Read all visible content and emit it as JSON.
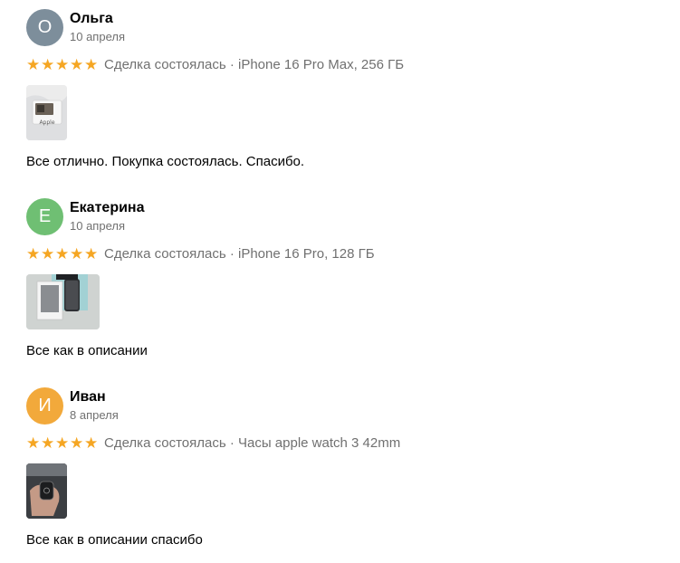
{
  "colors": {
    "star": "#f5a623",
    "secondary_text": "#707070",
    "primary_text": "#000000"
  },
  "reviews": [
    {
      "avatar_letter": "О",
      "avatar_color": "#7d8e9b",
      "name": "Ольга",
      "date": "10 апреля",
      "stars": 5,
      "deal": "Сделка состоялась · iPhone 16 Pro Max, 256 ГБ",
      "photo_caption": "Apple",
      "text": "Все отлично. Покупка состоялась. Спасибо."
    },
    {
      "avatar_letter": "Е",
      "avatar_color": "#6fbf73",
      "name": "Екатерина",
      "date": "10 апреля",
      "stars": 5,
      "deal": "Сделка состоялась · iPhone 16 Pro, 128 ГБ",
      "text": "Все как в описании"
    },
    {
      "avatar_letter": "И",
      "avatar_color": "#f2a93b",
      "name": "Иван",
      "date": "8 апреля",
      "stars": 5,
      "deal": "Сделка состоялась · Часы apple watch 3 42mm",
      "text": "Все как в описании спасибо"
    }
  ]
}
